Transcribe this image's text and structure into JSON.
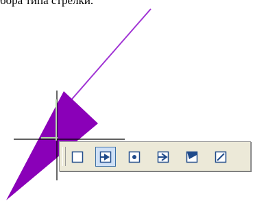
{
  "caption": "бора типа стрелки.",
  "colors": {
    "arrow_line": "#a033d4",
    "arrow_head": "#8a00b8",
    "cursor": "#000000",
    "toolbar_bg": "#ece9d8",
    "icon": "#1f4a8a"
  },
  "toolbar": {
    "buttons": [
      {
        "name": "no-arrow-icon",
        "active": false
      },
      {
        "name": "filled-triangle-arrow-icon",
        "active": true
      },
      {
        "name": "circle-endpoint-icon",
        "active": false
      },
      {
        "name": "open-arrow-icon",
        "active": false
      },
      {
        "name": "half-arrow-icon",
        "active": false
      },
      {
        "name": "line-slash-icon",
        "active": false
      }
    ]
  }
}
